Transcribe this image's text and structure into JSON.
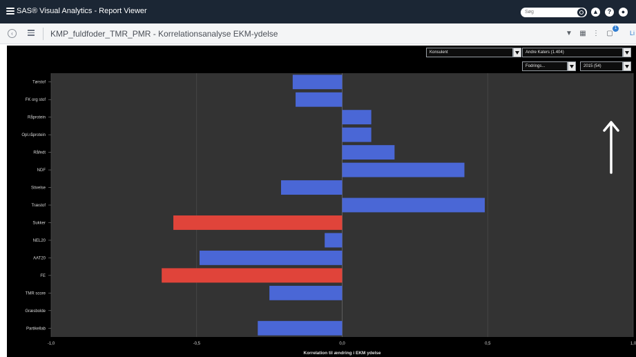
{
  "app": {
    "title": "SAS® Visual Analytics - Report Viewer",
    "search_placeholder": "Søg"
  },
  "report": {
    "title": "KMP_fuldfoder_TMR_PMR - Korrelationsanalyse EKM-ydelse",
    "user_label": "Li",
    "notification_count": "1"
  },
  "filters": {
    "konsulent": "Konsulent",
    "andre": "Andre Katers (1.404)",
    "fodrings": "Fodrings...",
    "year": "2015 (54)"
  },
  "colors": {
    "positive": "#4a67d6",
    "negative": "#e0443a",
    "plot_bg": "#333333"
  },
  "icons": {
    "app_menu": "hamburger-icon",
    "search": "search-icon",
    "help": "question-icon",
    "user": "user-icon",
    "back": "back-icon",
    "report_menu": "list-icon",
    "filter": "filter-icon",
    "share": "notification-icon"
  },
  "chart_data": {
    "type": "bar",
    "orientation": "horizontal",
    "categories": [
      "Tørstof",
      "FK org stof",
      "Råprotein",
      "Opl.råprotein",
      "Råfedt",
      "NDF",
      "Stivelse",
      "Træstof",
      "Sukker",
      "NEL20",
      "AAT20",
      "FE",
      "TMR score",
      "Græsbolde",
      "Partikellab"
    ],
    "values": [
      -0.17,
      -0.16,
      0.1,
      0.1,
      0.18,
      0.42,
      -0.21,
      0.49,
      -0.58,
      -0.06,
      -0.49,
      -0.62,
      -0.25,
      0.0,
      -0.29
    ],
    "bar_colors": [
      "#4a67d6",
      "#4a67d6",
      "#4a67d6",
      "#4a67d6",
      "#4a67d6",
      "#4a67d6",
      "#4a67d6",
      "#4a67d6",
      "#e0443a",
      "#4a67d6",
      "#4a67d6",
      "#e0443a",
      "#4a67d6",
      "#4a67d6",
      "#4a67d6"
    ],
    "xlim": [
      -1.0,
      1.0
    ],
    "xticks": [
      -1.0,
      -0.5,
      0.0,
      0.5,
      1.0
    ],
    "xtick_labels": [
      "-1,0",
      "-0,5",
      "0,0",
      "0,5",
      "1,0"
    ],
    "xlabel": "Korrelation til ændring i EKM ydelse",
    "ylabel": "",
    "grid": true
  }
}
